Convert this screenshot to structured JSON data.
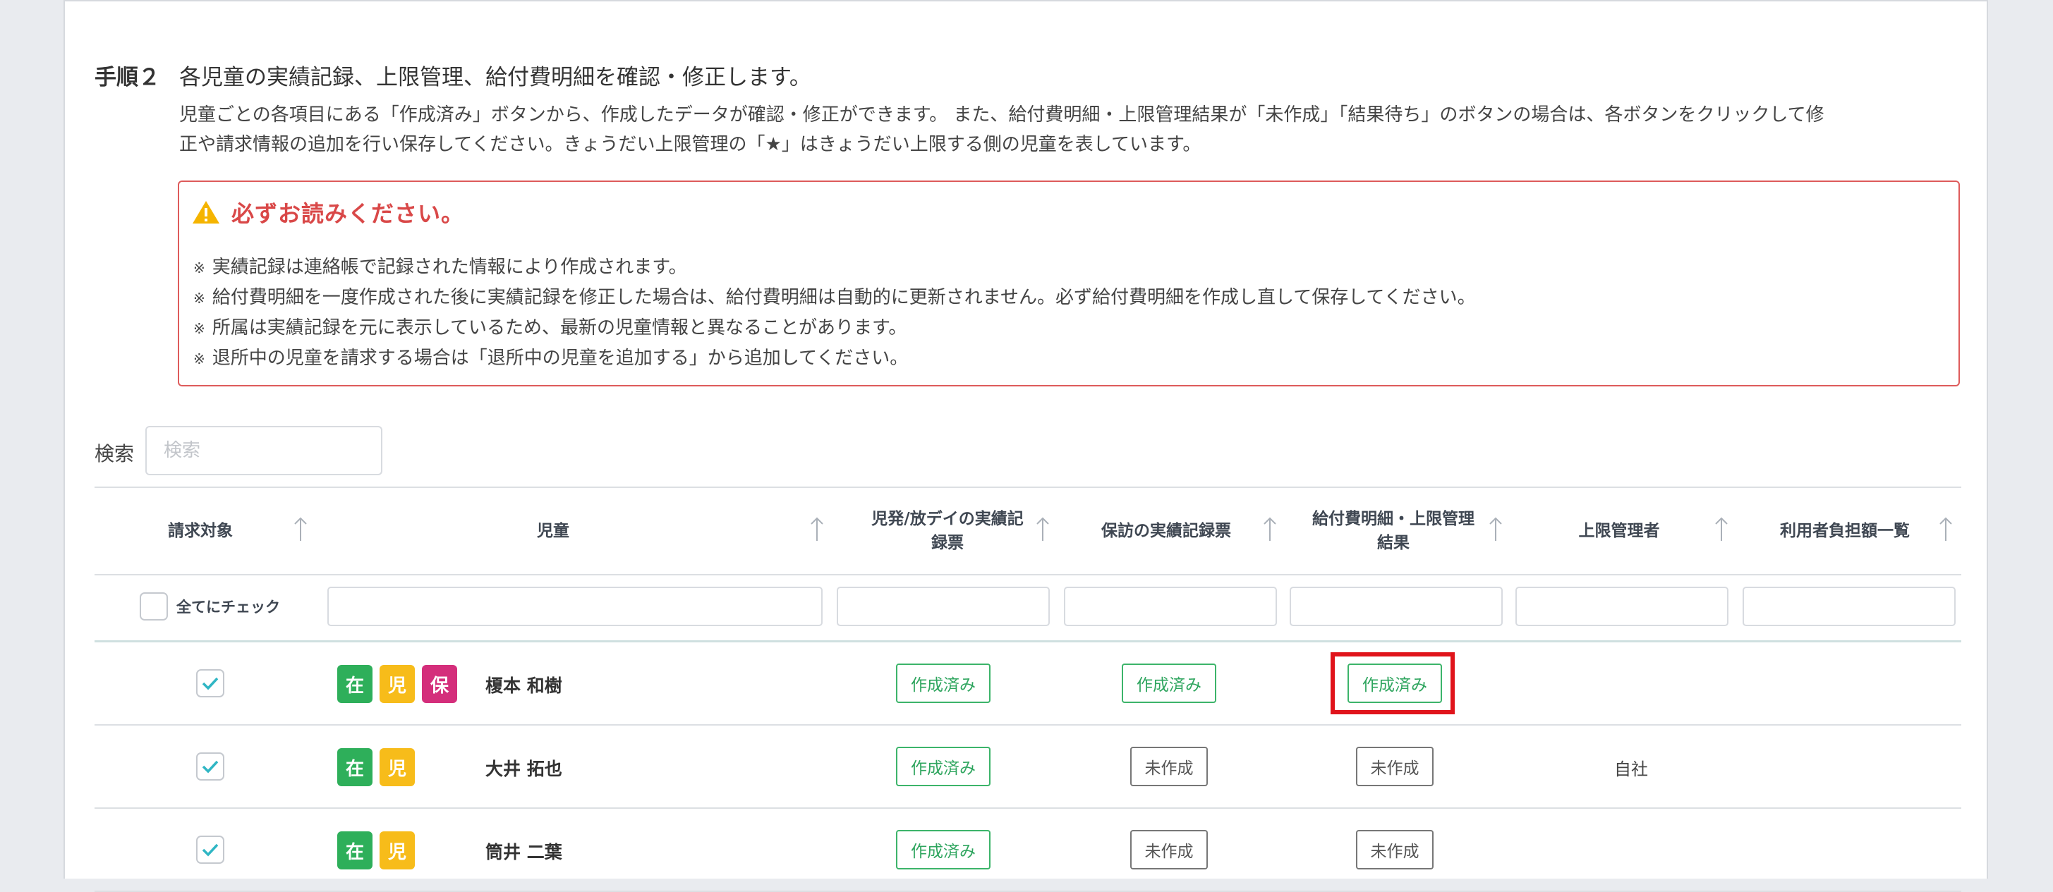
{
  "step": {
    "label": "手順２",
    "title": "各児童の実績記録、上限管理、給付費明細を確認・修正します。",
    "desc_line1": "児童ごとの各項目にある「作成済み」ボタンから、作成したデータが確認・修正ができます。 また、給付費明細・上限管理結果が「未作成」「結果待ち」のボタンの場合は、各ボタンをクリックして修",
    "desc_line2": "正や請求情報の追加を行い保存してください。きょうだい上限管理の「★」はきょうだい上限する側の児童を表しています。"
  },
  "warning": {
    "title": "必ずお読みください。",
    "mark": "※",
    "lines": [
      "実績記録は連絡帳で記録された情報により作成されます。",
      "給付費明細を一度作成された後に実績記録を修正した場合は、給付費明細は自動的に更新されません。必ず給付費明細を作成し直して保存してください。",
      "所属は実績記録を元に表示しているため、最新の児童情報と異なることがあります。",
      "退所中の児童を請求する場合は「退所中の児童を追加する」から追加してください。"
    ]
  },
  "search": {
    "label": "検索",
    "placeholder": "検索"
  },
  "table": {
    "headers": {
      "target": "請求対象",
      "child": "児童",
      "record1_l1": "児発/放デイの実績記",
      "record1_l2": "録票",
      "record2": "保訪の実績記録票",
      "benefit_l1": "給付費明細・上限管理",
      "benefit_l2": "結果",
      "manager": "上限管理者",
      "burden": "利用者負担額一覧"
    },
    "check_all_label": "全てにチェック",
    "rows": [
      {
        "badges": [
          "在",
          "児",
          "保"
        ],
        "name": "榎本 和樹",
        "record1": "作成済み",
        "record2": "作成済み",
        "benefit": "作成済み",
        "manager": ""
      },
      {
        "badges": [
          "在",
          "児"
        ],
        "name": "大井 拓也",
        "record1": "作成済み",
        "record2": "未作成",
        "benefit": "未作成",
        "manager": "自社"
      },
      {
        "badges": [
          "在",
          "児"
        ],
        "name": "筒井 二葉",
        "record1": "作成済み",
        "record2": "未作成",
        "benefit": "未作成",
        "manager": ""
      }
    ]
  },
  "colors": {
    "done": "#3cb46a",
    "highlight": "#e0141b",
    "warn": "#d94848"
  }
}
